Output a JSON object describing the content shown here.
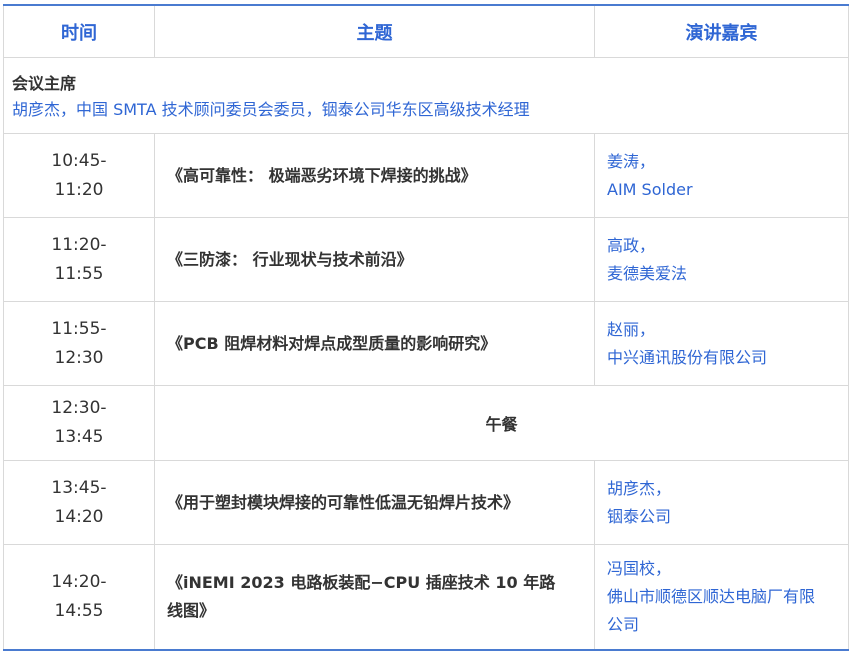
{
  "headers": {
    "time": "时间",
    "topic": "主题",
    "speaker": "演讲嘉宾"
  },
  "chair": {
    "title": "会议主席",
    "desc": "胡彦杰，中国 SMTA 技术顾问委员会委员，铟泰公司华东区高级技术经理"
  },
  "rows": [
    {
      "time_start": "10:45-",
      "time_end": "11:20",
      "topic": "《高可靠性： 极端恶劣环境下焊接的挑战》",
      "speaker_name": "姜涛，",
      "speaker_org": "AIM Solder"
    },
    {
      "time_start": "11:20-",
      "time_end": "11:55",
      "topic": "《三防漆： 行业现状与技术前沿》",
      "speaker_name": "高政，",
      "speaker_org": "麦德美爱法"
    },
    {
      "time_start": "11:55-",
      "time_end": "12:30",
      "topic": "《PCB 阻焊材料对焊点成型质量的影响研究》",
      "speaker_name": "赵丽，",
      "speaker_org": "中兴通讯股份有限公司"
    },
    {
      "time_start": "12:30-",
      "time_end": "13:45",
      "topic": "午餐"
    },
    {
      "time_start": "13:45-",
      "time_end": "14:20",
      "topic": "《用于塑封模块焊接的可靠性低温无铅焊片技术》",
      "speaker_name": "胡彦杰，",
      "speaker_org": "铟泰公司"
    },
    {
      "time_start": "14:20-",
      "time_end": "14:55",
      "topic_line1": "《iNEMI 2023 电路板装配−CPU 插座技术 10 年路",
      "topic_line2": "线图》",
      "speaker_name": "冯国校，",
      "speaker_org_line1": "佛山市顺德区顺达电脑厂有限",
      "speaker_org_line2": "公司"
    }
  ],
  "colors": {
    "accent": "#2f66d4",
    "rule": "#4a7bd0",
    "text": "#333333",
    "grid": "#d9d9d9"
  }
}
